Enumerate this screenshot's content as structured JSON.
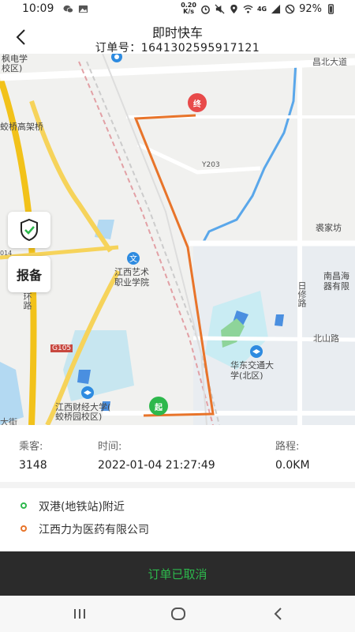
{
  "status_bar": {
    "time": "10:09",
    "speed_top": "0.20",
    "speed_bottom": "K/s",
    "network": "4G",
    "battery": "92%"
  },
  "header": {
    "title": "即时快车",
    "order_number": "订单号：1641302595917121"
  },
  "map": {
    "labels": {
      "top_left": "枫电学",
      "top_left2": "校区)",
      "changbei_road": "昌北大道",
      "jiaoqiao_bridge": "蛟桥高架桥",
      "y203": "Y203",
      "mijiafang": "裘家坊",
      "s014": "014",
      "ring_road": "环路",
      "art_college": "江西艺术\n职业学院",
      "rixiu_road": "日修路",
      "nanchang_co": "南昌海\n器有限",
      "beishan_road": "北山路",
      "g105": "G105",
      "jiaotong_univ": "华东交通大\n学(北区)",
      "finance_univ": "江西财经大学(\n蛟桥园校区)",
      "street": "大街"
    },
    "start_marker": "起",
    "end_marker": "终",
    "route_color": "#e8742a"
  },
  "buttons": {
    "report_label": "报备"
  },
  "trip_info": {
    "passenger_label": "乘客:",
    "passenger_value": "3148",
    "time_label": "时间:",
    "time_value": "2022-01-04 21:27:49",
    "distance_label": "路程:",
    "distance_value": "0.0KM"
  },
  "addresses": {
    "start": "双港(地铁站)附近",
    "end": "江西力为医药有限公司",
    "start_color": "#2db84c",
    "end_color": "#e8742a"
  },
  "order_status": "订单已取消"
}
